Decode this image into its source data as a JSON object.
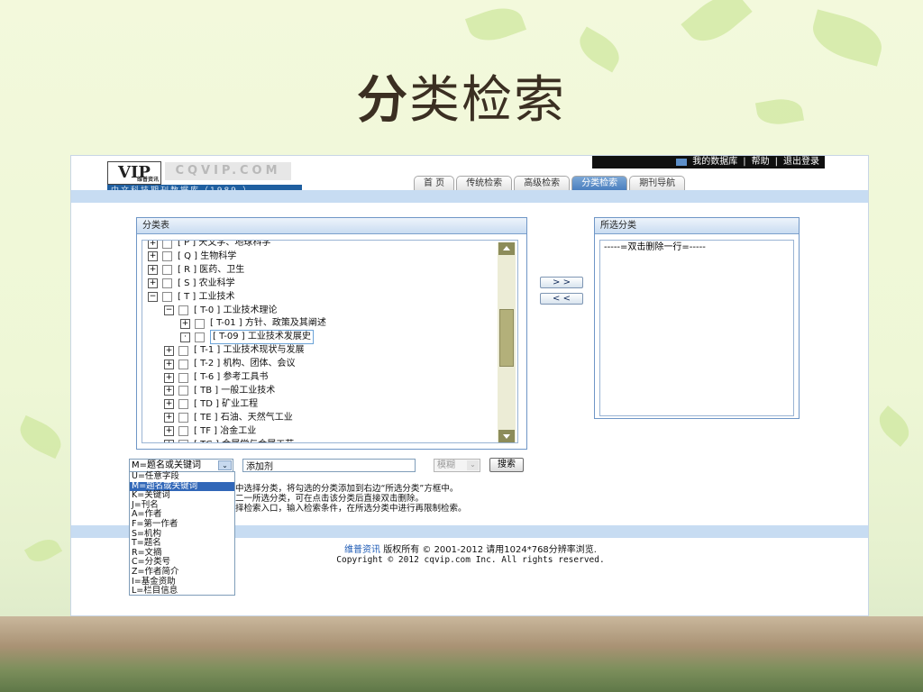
{
  "slide": {
    "title_bold": "分",
    "title_rest": "类检索"
  },
  "header": {
    "logo_mark": "VIP",
    "logo_sub": "维普资讯",
    "logo_brand": "CQVIP.COM",
    "logo_db": "中文科技期刊数据库（1989-）",
    "user_links": [
      "我的数据库",
      "|",
      "帮助",
      "|",
      "退出登录"
    ]
  },
  "nav": {
    "tabs": [
      "首  页",
      "传统检索",
      "高级检索",
      "分类检索",
      "期刊导航"
    ],
    "active_index": 3
  },
  "tree_panel": {
    "title": "分类表",
    "rows": [
      {
        "toggle": "+",
        "text": "[ P ] 天文学、地球科学"
      },
      {
        "toggle": "+",
        "text": "[ Q ] 生物科学"
      },
      {
        "toggle": "+",
        "text": "[ R ] 医药、卫生"
      },
      {
        "toggle": "+",
        "text": "[ S ] 农业科学"
      },
      {
        "toggle": "−",
        "text": "[ T ] 工业技术"
      },
      {
        "toggle": "−",
        "text": "[ T-0 ] 工业技术理论"
      },
      {
        "toggle": "+",
        "text": "[ T-01 ] 方针、政策及其阐述"
      },
      {
        "toggle": "·",
        "text": "[ T-09 ] 工业技术发展史"
      },
      {
        "toggle": "+",
        "text": "[ T-1 ] 工业技术现状与发展"
      },
      {
        "toggle": "+",
        "text": "[ T-2 ] 机构、团体、会议"
      },
      {
        "toggle": "+",
        "text": "[ T-6 ] 参考工具书"
      },
      {
        "toggle": "+",
        "text": "[ TB ] 一般工业技术"
      },
      {
        "toggle": "+",
        "text": "[ TD ] 矿业工程"
      },
      {
        "toggle": "+",
        "text": "[ TE ] 石油、天然气工业"
      },
      {
        "toggle": "+",
        "text": "[ TF ] 冶金工业"
      },
      {
        "toggle": "+",
        "text": "[ TG ] 金属学与金属工艺"
      }
    ]
  },
  "move_buttons": {
    "add": "> >",
    "remove": "< <"
  },
  "selected_panel": {
    "title": "所选分类",
    "hint": "-----=双击删除一行=-----"
  },
  "search": {
    "field_value": "M=题名或关键词",
    "keyword": "添加剂",
    "match_value": "模糊",
    "button": "搜索",
    "field_options": [
      "U=任意字段",
      "M=题名或关键词",
      "K=关键词",
      "J=刊名",
      "A=作者",
      "F=第一作者",
      "S=机构",
      "T=题名",
      "R=文摘",
      "C=分类号",
      "Z=作者简介",
      "I=基金资助",
      "L=栏目信息"
    ],
    "highlighted_index": 1
  },
  "help_lines": [
    "中选择分类，将勾选的分类添加到右边“所选分类”方框中。",
    "二一所选分类，可在点击该分类后直接双击删除。",
    "择检索入口，输入检索条件，在所选分类中进行再限制检索。"
  ],
  "footer": {
    "brand": "维普资讯",
    "copyright": " 版权所有 © 2001-2012 请用1024*768分辨率浏览.",
    "english": "Copyright © 2012 cqvip.com Inc. All rights reserved."
  },
  "colors": {
    "band_blue": "#c7dcf2",
    "panel_border": "#6f96c6",
    "highlight": "#3167b8",
    "active_tab": "#4a7fbf"
  }
}
